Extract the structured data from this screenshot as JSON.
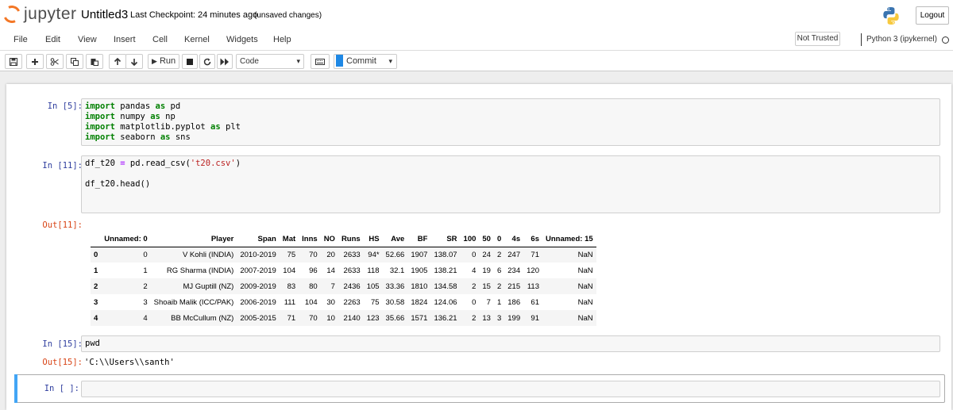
{
  "header": {
    "logo_text": "jupyter",
    "notebook_title": "Untitled3",
    "checkpoint": "Last Checkpoint: 24 minutes ago",
    "save_status": "(unsaved changes)",
    "logout_label": "Logout"
  },
  "menu": {
    "items": [
      "File",
      "Edit",
      "View",
      "Insert",
      "Cell",
      "Kernel",
      "Widgets",
      "Help"
    ],
    "trust_status": "Not Trusted",
    "kernel_name": "Python 3 (ipykernel)"
  },
  "toolbar": {
    "run_label": "Run",
    "cell_type": "Code",
    "commit_label": "Commit"
  },
  "cells": {
    "c1": {
      "prompt": "In [5]:"
    },
    "c2": {
      "prompt": "In [11]:",
      "line2": "df_t20.head()"
    },
    "c2_out": {
      "prompt": "Out[11]:"
    },
    "c3": {
      "prompt": "In [15]:",
      "code": "pwd"
    },
    "c3_out": {
      "prompt": "Out[15]:",
      "text": "'C:\\\\Users\\\\santh'"
    },
    "c4": {
      "prompt": "In [ ]:"
    }
  },
  "dataframe": {
    "columns": [
      "",
      "Unnamed: 0",
      "Player",
      "Span",
      "Mat",
      "Inns",
      "NO",
      "Runs",
      "HS",
      "Ave",
      "BF",
      "SR",
      "100",
      "50",
      "0",
      "4s",
      "6s",
      "Unnamed: 15"
    ],
    "rows": [
      [
        "0",
        "0",
        "V Kohli (INDIA)",
        "2010-2019",
        "75",
        "70",
        "20",
        "2633",
        "94*",
        "52.66",
        "1907",
        "138.07",
        "0",
        "24",
        "2",
        "247",
        "71",
        "NaN"
      ],
      [
        "1",
        "1",
        "RG Sharma (INDIA)",
        "2007-2019",
        "104",
        "96",
        "14",
        "2633",
        "118",
        "32.1",
        "1905",
        "138.21",
        "4",
        "19",
        "6",
        "234",
        "120",
        "NaN"
      ],
      [
        "2",
        "2",
        "MJ Guptill (NZ)",
        "2009-2019",
        "83",
        "80",
        "7",
        "2436",
        "105",
        "33.36",
        "1810",
        "134.58",
        "2",
        "15",
        "2",
        "215",
        "113",
        "NaN"
      ],
      [
        "3",
        "3",
        "Shoaib Malik (ICC/PAK)",
        "2006-2019",
        "111",
        "104",
        "30",
        "2263",
        "75",
        "30.58",
        "1824",
        "124.06",
        "0",
        "7",
        "1",
        "186",
        "61",
        "NaN"
      ],
      [
        "4",
        "4",
        "BB McCullum (NZ)",
        "2005-2015",
        "71",
        "70",
        "10",
        "2140",
        "123",
        "35.66",
        "1571",
        "136.21",
        "2",
        "13",
        "3",
        "199",
        "91",
        "NaN"
      ]
    ]
  }
}
